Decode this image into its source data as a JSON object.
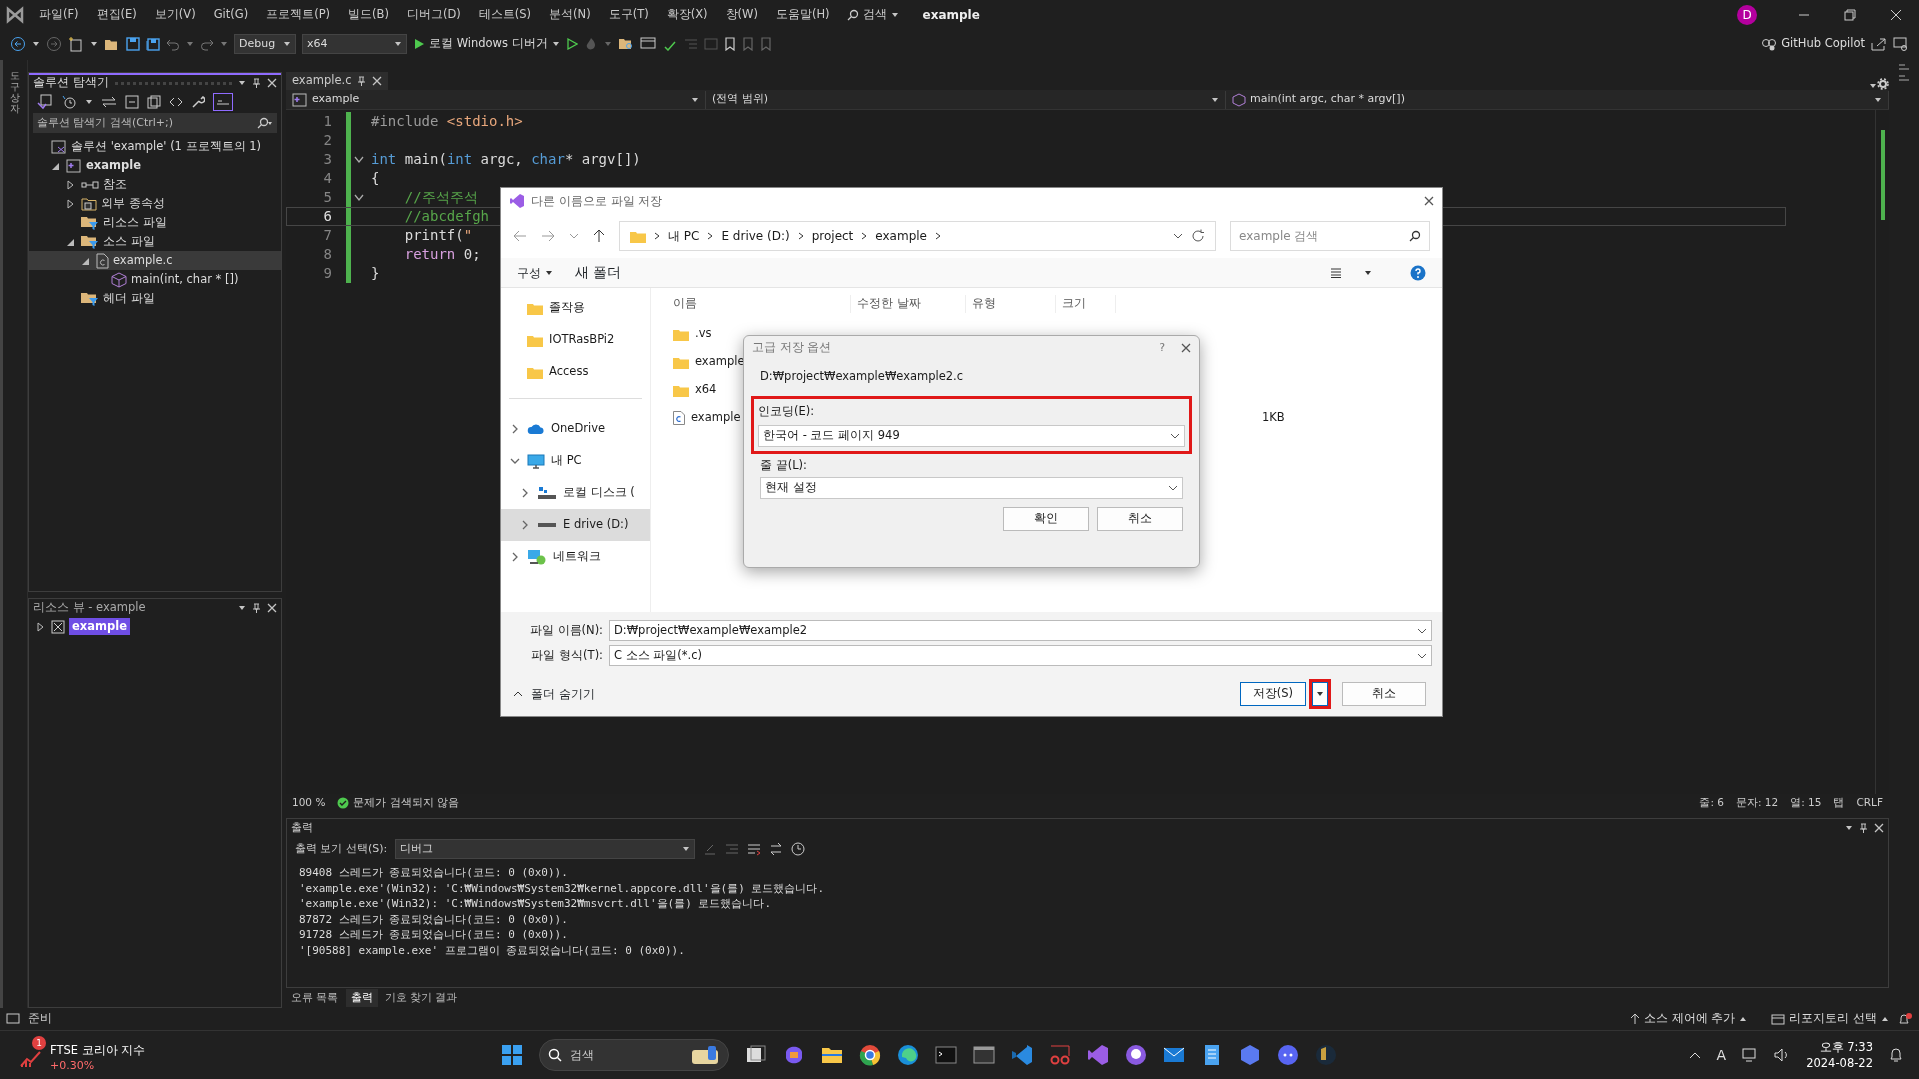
{
  "menu": [
    "파일(F)",
    "편집(E)",
    "보기(V)",
    "Git(G)",
    "프로젝트(P)",
    "빌드(B)",
    "디버그(D)",
    "테스트(S)",
    "분석(N)",
    "도구(T)",
    "확장(X)",
    "창(W)",
    "도움말(H)"
  ],
  "search_label": "검색",
  "window_title": "example",
  "account_initial": "D",
  "toolbar": {
    "configuration": "Debug",
    "platform": "x64",
    "run_label": "로컬 Windows 디버거",
    "copilot": "GitHub Copilot"
  },
  "side_strip": "도구 상자",
  "solution_explorer": {
    "title": "솔루션 탐색기",
    "search_placeholder": "솔루션 탐색기 검색(Ctrl+;)",
    "tree": [
      {
        "label": "솔루션 'example' (1 프로젝트의 1)",
        "kind": "solution",
        "selected": false,
        "children": [
          {
            "label": "example",
            "kind": "project",
            "expanded": true,
            "selected": false,
            "children": [
              {
                "label": "참조",
                "kind": "reference",
                "expanded": false,
                "selected": false
              },
              {
                "label": "외부 종속성",
                "kind": "external",
                "expanded": false,
                "selected": false
              },
              {
                "label": "리소스 파일",
                "kind": "filter",
                "selected": false
              },
              {
                "label": "소스 파일",
                "kind": "filter",
                "expanded": true,
                "selected": false,
                "children": [
                  {
                    "label": "example.c",
                    "kind": "cfile",
                    "expanded": true,
                    "selected": true,
                    "children": [
                      {
                        "label": "main(int, char * [])",
                        "kind": "method",
                        "selected": false
                      }
                    ]
                  }
                ]
              },
              {
                "label": "헤더 파일",
                "kind": "filter",
                "selected": false
              }
            ]
          }
        ]
      }
    ]
  },
  "resource_view": {
    "title": "리소스 뷰 - example",
    "tree": [
      {
        "label": "example",
        "kind": "resource",
        "expanded": false,
        "selected": true
      }
    ]
  },
  "editor": {
    "tab": "example.c",
    "nav": [
      "example",
      "(전역 범위)",
      "main(int argc, char * argv[])"
    ],
    "lines": [
      {
        "number": "1",
        "current": false,
        "fold": false,
        "tokens": [
          {
            "t": "#include ",
            "kind": "directive"
          },
          {
            "t": "<stdio.h>",
            "kind": "string"
          }
        ]
      },
      {
        "number": "2",
        "current": false,
        "fold": false
      },
      {
        "number": "3",
        "current": false,
        "fold": true,
        "tokens": [
          {
            "t": "int",
            "kind": "keyword"
          },
          {
            "t": " main(",
            "kind": "plain"
          },
          {
            "t": "int",
            "kind": "keyword"
          },
          {
            "t": " argc, ",
            "kind": "plain"
          },
          {
            "t": "char",
            "kind": "keyword"
          },
          {
            "t": "* argv[])",
            "kind": "plain"
          }
        ]
      },
      {
        "number": "4",
        "current": false,
        "fold": false,
        "tokens": [
          {
            "t": "{",
            "kind": "plain"
          }
        ]
      },
      {
        "number": "5",
        "current": false,
        "fold": true,
        "tokens": [
          {
            "t": "    //주석주석",
            "kind": "comment"
          }
        ]
      },
      {
        "number": "6",
        "current": true,
        "fold": false,
        "tokens": [
          {
            "t": "    //abcdefgh",
            "kind": "comment"
          }
        ]
      },
      {
        "number": "7",
        "current": false,
        "fold": false,
        "tokens": [
          {
            "t": "    printf(",
            "kind": "plain"
          },
          {
            "t": "\"",
            "kind": "string"
          }
        ]
      },
      {
        "number": "8",
        "current": false,
        "fold": false,
        "tokens": [
          {
            "t": "    return",
            "kind": "control"
          },
          {
            "t": " 0;",
            "kind": "plain"
          }
        ]
      },
      {
        "number": "9",
        "current": false,
        "fold": false,
        "tokens": [
          {
            "t": "}",
            "kind": "plain"
          }
        ]
      }
    ],
    "status": {
      "zoom": "100 %",
      "issues": "문제가 검색되지 않음",
      "line": "줄: 6",
      "char": "문자: 12",
      "col": "열: 15",
      "indent": "탭",
      "eol": "CRLF"
    }
  },
  "output": {
    "title": "출력",
    "source_label": "출력 보기 선택(S):",
    "source": "디버그",
    "lines": [
      "89408 스레드가 종료되었습니다(코드: 0 (0x0)).",
      "'example.exe'(Win32): 'C:₩Windows₩System32₩kernel.appcore.dll'을(를) 로드했습니다.",
      "'example.exe'(Win32): 'C:₩Windows₩System32₩msvcrt.dll'을(를) 로드했습니다.",
      "87872 스레드가 종료되었습니다(코드: 0 (0x0)).",
      "91728 스레드가 종료되었습니다(코드: 0 (0x0)).",
      "'[90588] example.exe' 프로그램이 종료되었습니다(코드: 0 (0x0))."
    ]
  },
  "bottom_tabs": [
    {
      "label": "오류 목록",
      "selected": false
    },
    {
      "label": "출력",
      "selected": true
    },
    {
      "label": "기호 찾기 결과",
      "selected": false
    }
  ],
  "status_bar": {
    "text": "준비",
    "source_control": "소스 제어에 추가",
    "repository": "리포지토리 선택"
  },
  "save_dialog": {
    "title": "다른 이름으로 파일 저장",
    "breadcrumb": [
      "내 PC",
      "E drive (D:)",
      "project",
      "example"
    ],
    "search_placeholder": "example 검색",
    "organize": "구성",
    "new_folder": "새 폴더",
    "nav": [
      {
        "label": "졸작용",
        "kind": "folder",
        "selected": false
      },
      {
        "label": "IOTRasBPi2",
        "kind": "folder",
        "selected": false
      },
      {
        "label": "Access",
        "kind": "folder",
        "selected": false
      },
      {
        "label": "OneDrive",
        "kind": "cloud",
        "expanded": false,
        "selected": false
      },
      {
        "label": "내 PC",
        "kind": "pc",
        "expanded": true,
        "selected": false
      },
      {
        "label": "로컬 디스크 (",
        "kind": "disk",
        "expanded": false,
        "selected": false
      },
      {
        "label": "E drive (D:)",
        "kind": "drive",
        "expanded": false,
        "selected": true
      },
      {
        "label": "네트워크",
        "kind": "network",
        "expanded": false,
        "selected": false
      }
    ],
    "columns": [
      "이름",
      "수정한 날짜",
      "유형",
      "크기"
    ],
    "files": [
      {
        "name": ".vs",
        "kind": "folder"
      },
      {
        "name": "example",
        "kind": "folder"
      },
      {
        "name": "x64",
        "kind": "folder"
      },
      {
        "name": "example",
        "kind": "cfile",
        "size": "1KB"
      }
    ],
    "file_name_label": "파일 이름(N):",
    "file_name": "D:₩project₩example₩example2",
    "file_type_label": "파일 형식(T):",
    "file_type": "C 소스 파일(*.c)",
    "hide_folders": "폴더 숨기기",
    "save": "저장(S)",
    "save_highlighted": true,
    "cancel": "취소"
  },
  "options_dialog": {
    "title": "고급 저장 옵션",
    "help": "?",
    "path": "D:₩project₩example₩example2.c",
    "encoding_label": "인코딩(E):",
    "encoding": "한국어 - 코드 페이지 949",
    "encoding_highlighted": true,
    "line_ending_label": "줄 끝(L):",
    "line_ending": "현재 설정",
    "ok": "확인",
    "cancel": "취소"
  },
  "taskbar": {
    "widget_title": "FTSE 코리아 지수",
    "widget_change": "+0.30%",
    "widget_badge": "1",
    "search": "검색",
    "ime": "A",
    "time": "오후 7:33",
    "date": "2024-08-22"
  }
}
